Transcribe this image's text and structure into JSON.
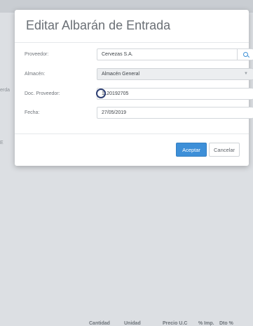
{
  "background": {
    "left_fragment": "erda",
    "left_fragment2": "E",
    "table_headers": [
      "Cantidad",
      "Unidad",
      "Precio U.C",
      "% Imp.",
      "Dto %"
    ]
  },
  "modal": {
    "title": "Editar Albarán de Entrada",
    "fields": {
      "proveedor": {
        "label": "Proveedor:",
        "value": "Cervezas S.A."
      },
      "almacen": {
        "label": "Almacén:",
        "value": "Almacén General"
      },
      "doc_proveedor": {
        "label": "Doc. Proveedor:",
        "value": "1120192705"
      },
      "fecha": {
        "label": "Fecha:",
        "value": "27/05/2019"
      }
    },
    "buttons": {
      "accept": "Aceptar",
      "cancel": "Cancelar"
    }
  },
  "colors": {
    "primary": "#3d8fd8",
    "title": "#6a6f75"
  },
  "icons": [
    "search-icon",
    "chevron-down-icon"
  ]
}
